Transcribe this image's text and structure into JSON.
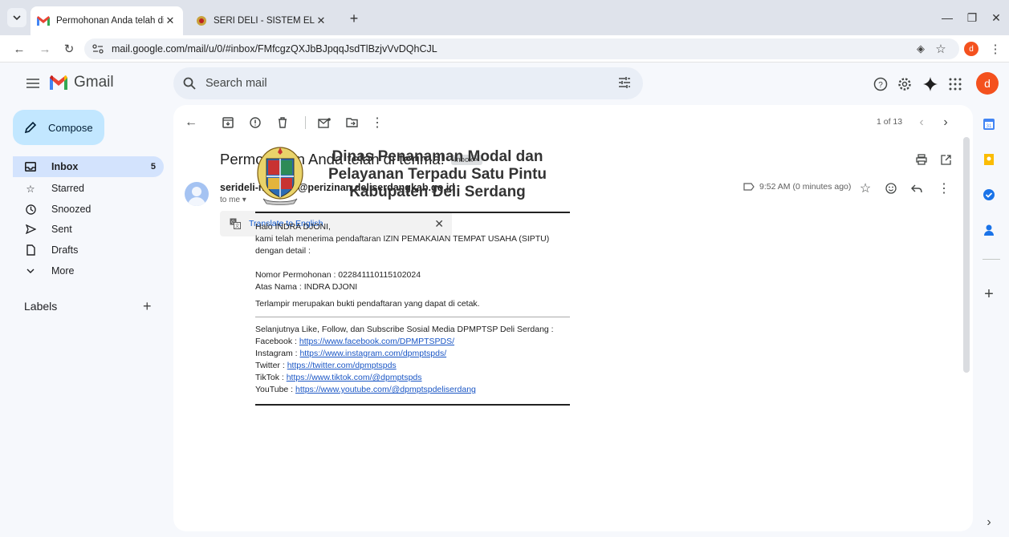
{
  "browser": {
    "tabs": [
      {
        "title": "Permohonan Anda telah di terima",
        "active": true
      },
      {
        "title": "SERI DELI - SISTEM ELEKTRONIK",
        "active": false
      }
    ],
    "url": "mail.google.com/mail/u/0/#inbox/FMfcgzQXJbBJpqqJsdTlBzjvVvDQhCJL",
    "profile_initial": "d"
  },
  "gmail": {
    "app_name": "Gmail",
    "search_placeholder": "Search mail",
    "account_initial": "d",
    "compose_label": "Compose",
    "nav": [
      {
        "label": "Inbox",
        "count": "5",
        "icon": "inbox-icon"
      },
      {
        "label": "Starred",
        "count": "",
        "icon": "star-icon"
      },
      {
        "label": "Snoozed",
        "count": "",
        "icon": "clock-icon"
      },
      {
        "label": "Sent",
        "count": "",
        "icon": "send-icon"
      },
      {
        "label": "Drafts",
        "count": "",
        "icon": "draft-icon"
      },
      {
        "label": "More",
        "count": "",
        "icon": "chevron-down-icon"
      }
    ],
    "labels_heading": "Labels"
  },
  "message": {
    "page_count": "1 of 13",
    "subject": "Permohonan Anda telah di terima!",
    "label_chip": "Inbox ×",
    "sender": "serideli-no-reply@perizinan.deliserdangkab.go.id",
    "to": "to me",
    "time": "9:52 AM (0 minutes ago)",
    "translate_label": "Translate to English"
  },
  "email_body": {
    "org_lines": [
      "Dinas Penanaman Modal dan",
      "Pelayanan Terpadu Satu Pintu",
      "Kabupaten Deli Serdang"
    ],
    "greeting": "Halo INDRA DJONI,",
    "line1": "kami telah menerima pendaftaran IZIN PEMAKAIAN TEMPAT USAHA (SIPTU)",
    "line2": "dengan detail :",
    "nomor": "Nomor Permohonan : 022841110115102024",
    "atas_nama": "Atas Nama : INDRA DJONI",
    "lampiran": "Terlampir merupakan bukti pendaftaran yang dapat di cetak.",
    "social_intro": "Selanjutnya Like, Follow, dan Subscribe Sosial Media DPMPTSP Deli Serdang :",
    "social": [
      {
        "name": "Facebook : ",
        "url": "https://www.facebook.com/DPMPTSPDS/"
      },
      {
        "name": "Instagram : ",
        "url": "https://www.instagram.com/dpmptspds/"
      },
      {
        "name": "Twitter : ",
        "url": "https://twitter.com/dpmptspds"
      },
      {
        "name": "TikTok : ",
        "url": "https://www.tiktok.com/@dpmptspds"
      },
      {
        "name": "YouTube : ",
        "url": "https://www.youtube.com/@dpmptspdeliserdang"
      }
    ]
  },
  "colors": {
    "accent": "#0b57d0",
    "compose": "#c2e7ff",
    "active_nav": "#d3e3fd",
    "avatar": "#f4511e"
  }
}
